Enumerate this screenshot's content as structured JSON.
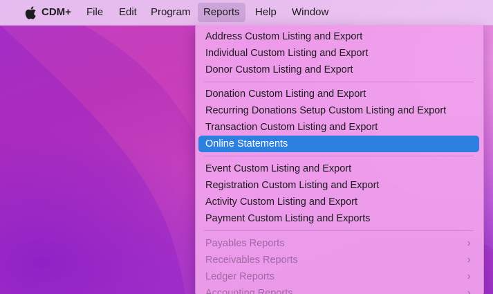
{
  "menubar": {
    "apple_icon": "apple-icon",
    "items": [
      {
        "label": "CDM+"
      },
      {
        "label": "File"
      },
      {
        "label": "Edit"
      },
      {
        "label": "Program"
      },
      {
        "label": "Reports"
      },
      {
        "label": "Help"
      },
      {
        "label": "Window"
      }
    ],
    "active_item": "Reports"
  },
  "reports_menu": {
    "groups": [
      {
        "items": [
          {
            "label": "Address Custom Listing and Export"
          },
          {
            "label": "Individual Custom Listing and Export"
          },
          {
            "label": "Donor Custom Listing and Export"
          }
        ]
      },
      {
        "items": [
          {
            "label": "Donation Custom Listing and Export"
          },
          {
            "label": "Recurring Donations Setup Custom Listing and Export"
          },
          {
            "label": "Transaction Custom Listing and Export"
          },
          {
            "label": "Online Statements",
            "selected": true
          }
        ]
      },
      {
        "items": [
          {
            "label": "Event Custom Listing and Export"
          },
          {
            "label": "Registration Custom Listing and Export"
          },
          {
            "label": "Activity Custom Listing and Export"
          },
          {
            "label": "Payment Custom Listing and Exports"
          }
        ]
      },
      {
        "items": [
          {
            "label": "Payables Reports",
            "disabled": true,
            "submenu_icon": "chevron-right-icon"
          },
          {
            "label": "Receivables Reports",
            "disabled": true,
            "submenu_icon": "chevron-right-icon"
          },
          {
            "label": "Ledger Reports",
            "disabled": true,
            "submenu_icon": "chevron-right-icon"
          },
          {
            "label": "Accounting Reports",
            "disabled": true,
            "submenu_icon": "chevron-right-icon"
          }
        ]
      }
    ],
    "chevron_glyph": "›"
  },
  "colors": {
    "selection": "#2d7fe0",
    "menu_background": "#efa0ec",
    "menubar_background": "#eccef4"
  }
}
